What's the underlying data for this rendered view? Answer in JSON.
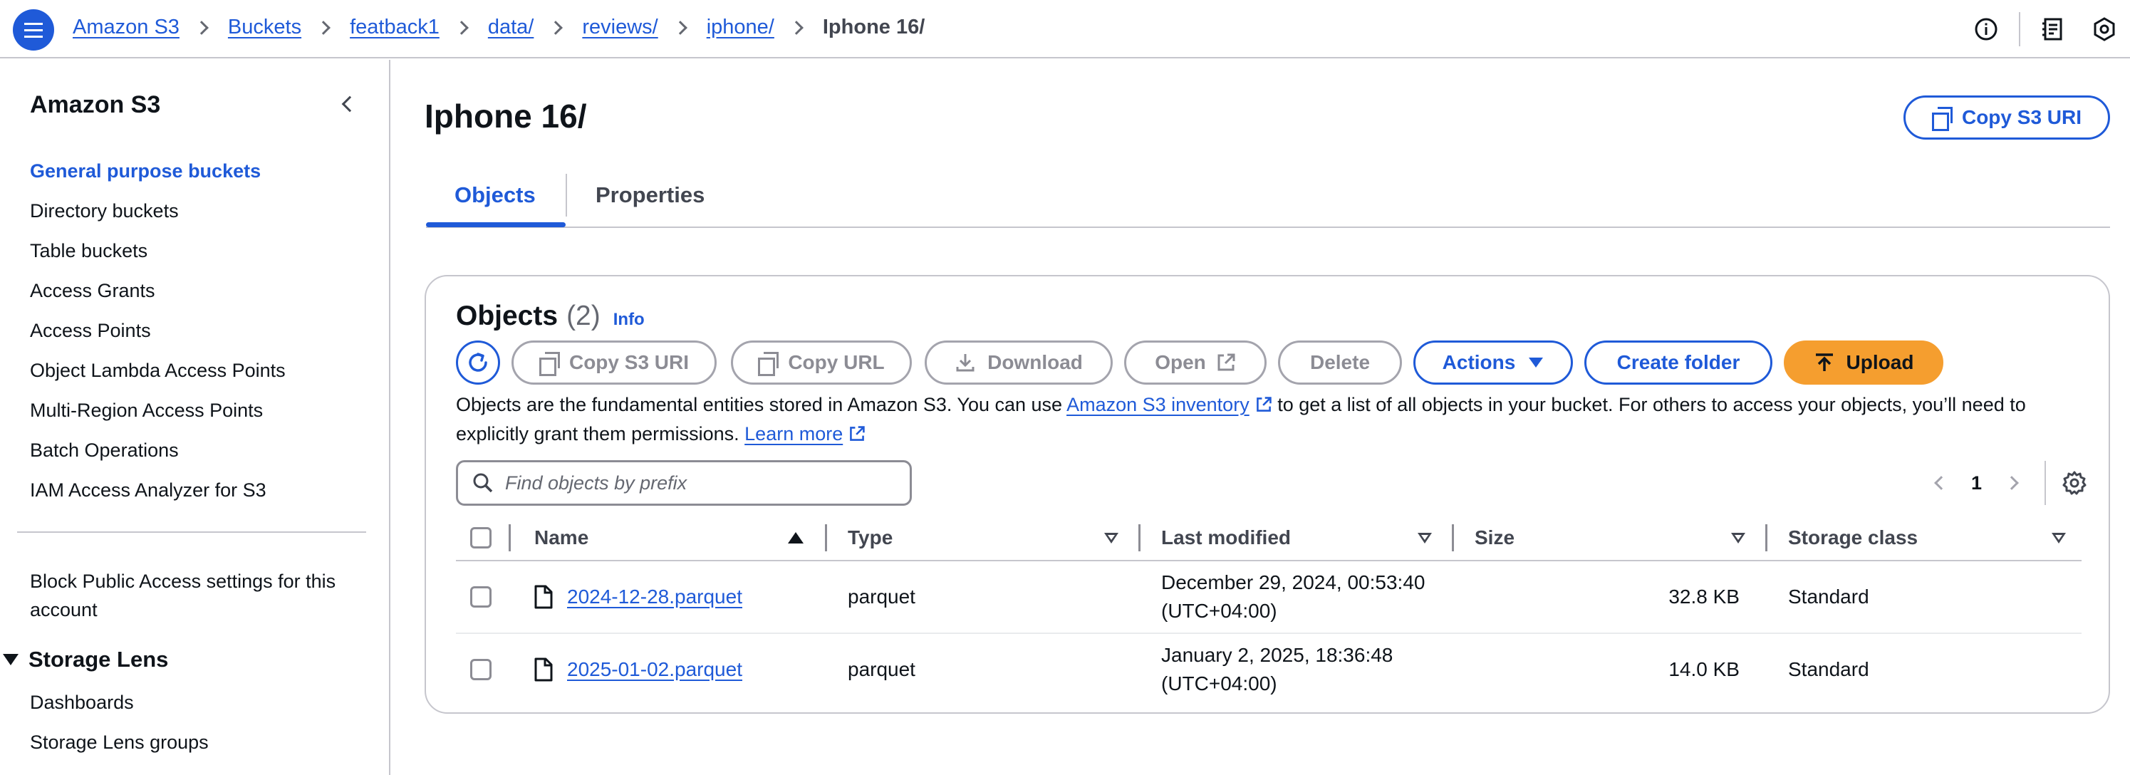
{
  "topbar": {
    "breadcrumbs": [
      {
        "label": "Amazon S3"
      },
      {
        "label": "Buckets"
      },
      {
        "label": "featback1"
      },
      {
        "label": "data/"
      },
      {
        "label": "reviews/"
      },
      {
        "label": "iphone/"
      }
    ],
    "current": "Iphone 16/",
    "icons": [
      "info-icon",
      "feedback-icon",
      "settings-hexagon-icon"
    ]
  },
  "sidebar": {
    "title": "Amazon S3",
    "items": [
      {
        "label": "General purpose buckets",
        "active": true
      },
      {
        "label": "Directory buckets"
      },
      {
        "label": "Table buckets"
      },
      {
        "label": "Access Grants"
      },
      {
        "label": "Access Points"
      },
      {
        "label": "Object Lambda Access Points"
      },
      {
        "label": "Multi-Region Access Points"
      },
      {
        "label": "Batch Operations"
      },
      {
        "label": "IAM Access Analyzer for S3"
      }
    ],
    "block_public_access": "Block Public Access settings for this account",
    "storage_lens": {
      "title": "Storage Lens",
      "items": [
        {
          "label": "Dashboards"
        },
        {
          "label": "Storage Lens groups"
        }
      ]
    }
  },
  "main": {
    "title": "Iphone 16/",
    "copy_uri_label": "Copy S3 URI",
    "tabs": [
      {
        "label": "Objects",
        "active": true
      },
      {
        "label": "Properties"
      }
    ]
  },
  "objects": {
    "title": "Objects",
    "count": "(2)",
    "info": "Info",
    "buttons": {
      "copy_uri": "Copy S3 URI",
      "copy_url": "Copy URL",
      "download": "Download",
      "open": "Open",
      "delete": "Delete",
      "actions": "Actions",
      "create_folder": "Create folder",
      "upload": "Upload"
    },
    "description": {
      "part1": "Objects are the fundamental entities stored in Amazon S3. You can use ",
      "inventory_link": "Amazon S3 inventory",
      "part2": " to get a list of all objects in your bucket. For others to access your objects, you’ll need to explicitly grant them permissions. ",
      "learn_more": "Learn more"
    },
    "search_placeholder": "Find objects by prefix",
    "page": "1",
    "columns": {
      "name": "Name",
      "type": "Type",
      "last_modified": "Last modified",
      "size": "Size",
      "storage_class": "Storage class"
    },
    "rows": [
      {
        "name": "2024-12-28.parquet",
        "type": "parquet",
        "modified_line1": "December 29, 2024, 00:53:40",
        "modified_line2": "(UTC+04:00)",
        "size": "32.8 KB",
        "storage_class": "Standard"
      },
      {
        "name": "2025-01-02.parquet",
        "type": "parquet",
        "modified_line1": "January 2, 2025, 18:36:48",
        "modified_line2": "(UTC+04:00)",
        "size": "14.0 KB",
        "storage_class": "Standard"
      }
    ]
  },
  "colors": {
    "accent": "#1f5ad8",
    "upload": "#f59e2f",
    "border": "#c6c6cd"
  }
}
